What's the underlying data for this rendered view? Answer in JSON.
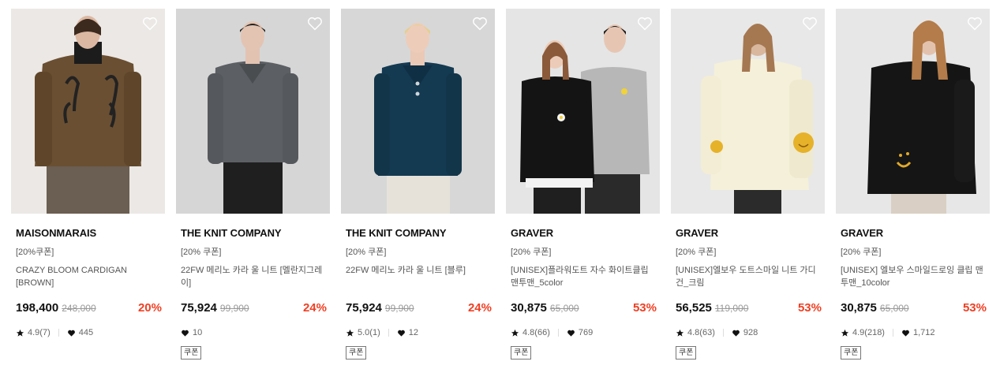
{
  "products": [
    {
      "brand": "MAISONMARAIS",
      "coupon_text": "[20%쿠폰]",
      "name": "CRAZY BLOOM CARDIGAN [BROWN]",
      "price": "198,400",
      "original_price": "248,000",
      "discount": "20%",
      "rating": "4.9(7)",
      "likes": "445",
      "coupon_badge": "",
      "image_bg": "#e9e6e3"
    },
    {
      "brand": "THE KNIT COMPANY",
      "coupon_text": "[20% 쿠폰]",
      "name": "22FW 메리노 카라 울 니트 [멜란지그레이]",
      "price": "75,924",
      "original_price": "99,900",
      "discount": "24%",
      "rating": "",
      "likes": "10",
      "coupon_badge": "쿠폰",
      "image_bg": "#d9d9d9"
    },
    {
      "brand": "THE KNIT COMPANY",
      "coupon_text": "[20% 쿠폰]",
      "name": "22FW 메리노 카라 울 니트 [블루]",
      "price": "75,924",
      "original_price": "99,900",
      "discount": "24%",
      "rating": "5.0(1)",
      "likes": "12",
      "coupon_badge": "쿠폰",
      "image_bg": "#d8d8d8"
    },
    {
      "brand": "GRAVER",
      "coupon_text": "[20% 쿠폰]",
      "name": "[UNISEX]플라워도트 자수 화이트클립 맨투맨_5color",
      "price": "30,875",
      "original_price": "65,000",
      "discount": "53%",
      "rating": "4.8(66)",
      "likes": "769",
      "coupon_badge": "쿠폰",
      "image_bg": "#e6e6e6"
    },
    {
      "brand": "GRAVER",
      "coupon_text": "[20% 쿠폰]",
      "name": "[UNISEX]엘보우 도트스마일 니트 가디건_크림",
      "price": "56,525",
      "original_price": "119,000",
      "discount": "53%",
      "rating": "4.8(63)",
      "likes": "928",
      "coupon_badge": "쿠폰",
      "image_bg": "#e8e8e8"
    },
    {
      "brand": "GRAVER",
      "coupon_text": "[20% 쿠폰]",
      "name": "[UNISEX] 엘보우 스마일드로잉 클립 맨투맨_10color",
      "price": "30,875",
      "original_price": "65,000",
      "discount": "53%",
      "rating": "4.9(218)",
      "likes": "1,712",
      "coupon_badge": "쿠폰",
      "image_bg": "#e7e7e7"
    }
  ],
  "colors": {
    "discount": "#ef3f23",
    "text": "#111111",
    "muted": "#555555"
  },
  "icons": {
    "wishlist": "heart-outline-icon",
    "rating": "star-icon",
    "likes": "heart-filled-icon"
  }
}
